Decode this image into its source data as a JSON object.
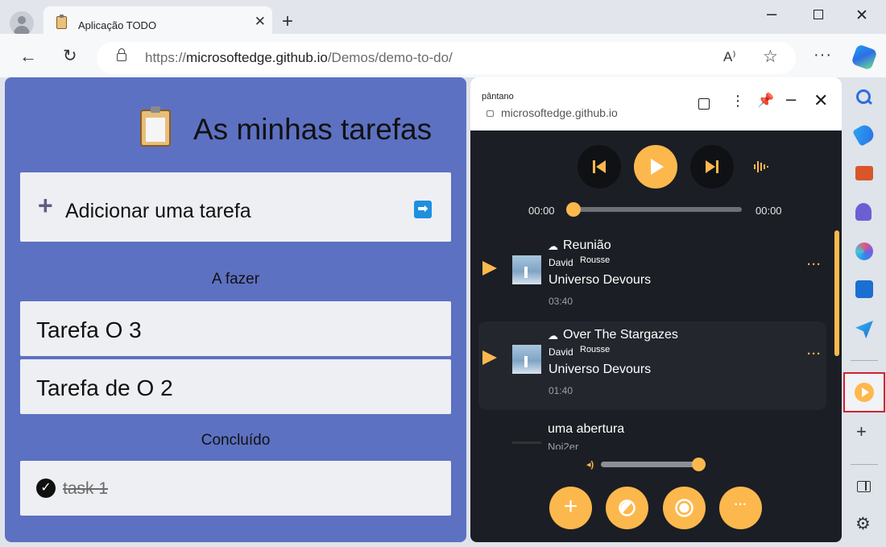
{
  "browser": {
    "tab_title": "Aplicação TODO",
    "url_prefix": "https://",
    "url_host": "microsoftedge.github.io",
    "url_path": "/Demos/demo-to-do/",
    "read_aloud_label": "A⁾"
  },
  "todo": {
    "title": "As minhas tarefas",
    "add_label": "Adicionar uma tarefa",
    "todo_section": "A fazer",
    "tasks": [
      "Tarefa O 3",
      "Tarefa de O 2"
    ],
    "done_section": "Concluído",
    "done_tasks": [
      "task 1"
    ]
  },
  "player": {
    "app_name": "pântano",
    "app_host": "microsoftedge.github.io",
    "time_start": "00:00",
    "time_end": "00:00",
    "seek_fraction": 0,
    "volume_fraction": 0.93,
    "tracks": [
      {
        "title": "Reunião",
        "artist_first": "David",
        "artist_last": "Rousse",
        "album": "Universo Devours",
        "duration": "03:40"
      },
      {
        "title": "Over The Stargazes",
        "artist_first": "David",
        "artist_last": "Rousse",
        "album": "Universo Devours",
        "duration": "01:40"
      },
      {
        "title": "uma abertura",
        "partial_line": "Noi2er"
      }
    ],
    "accent_color": "#fdb84d"
  },
  "icons": {
    "sidebar": [
      "search-icon",
      "tag-icon",
      "tools-icon",
      "games-icon",
      "office-icon",
      "outlook-icon",
      "send-icon",
      "player-app-icon",
      "add-icon",
      "panel-icon",
      "gear-icon"
    ]
  }
}
